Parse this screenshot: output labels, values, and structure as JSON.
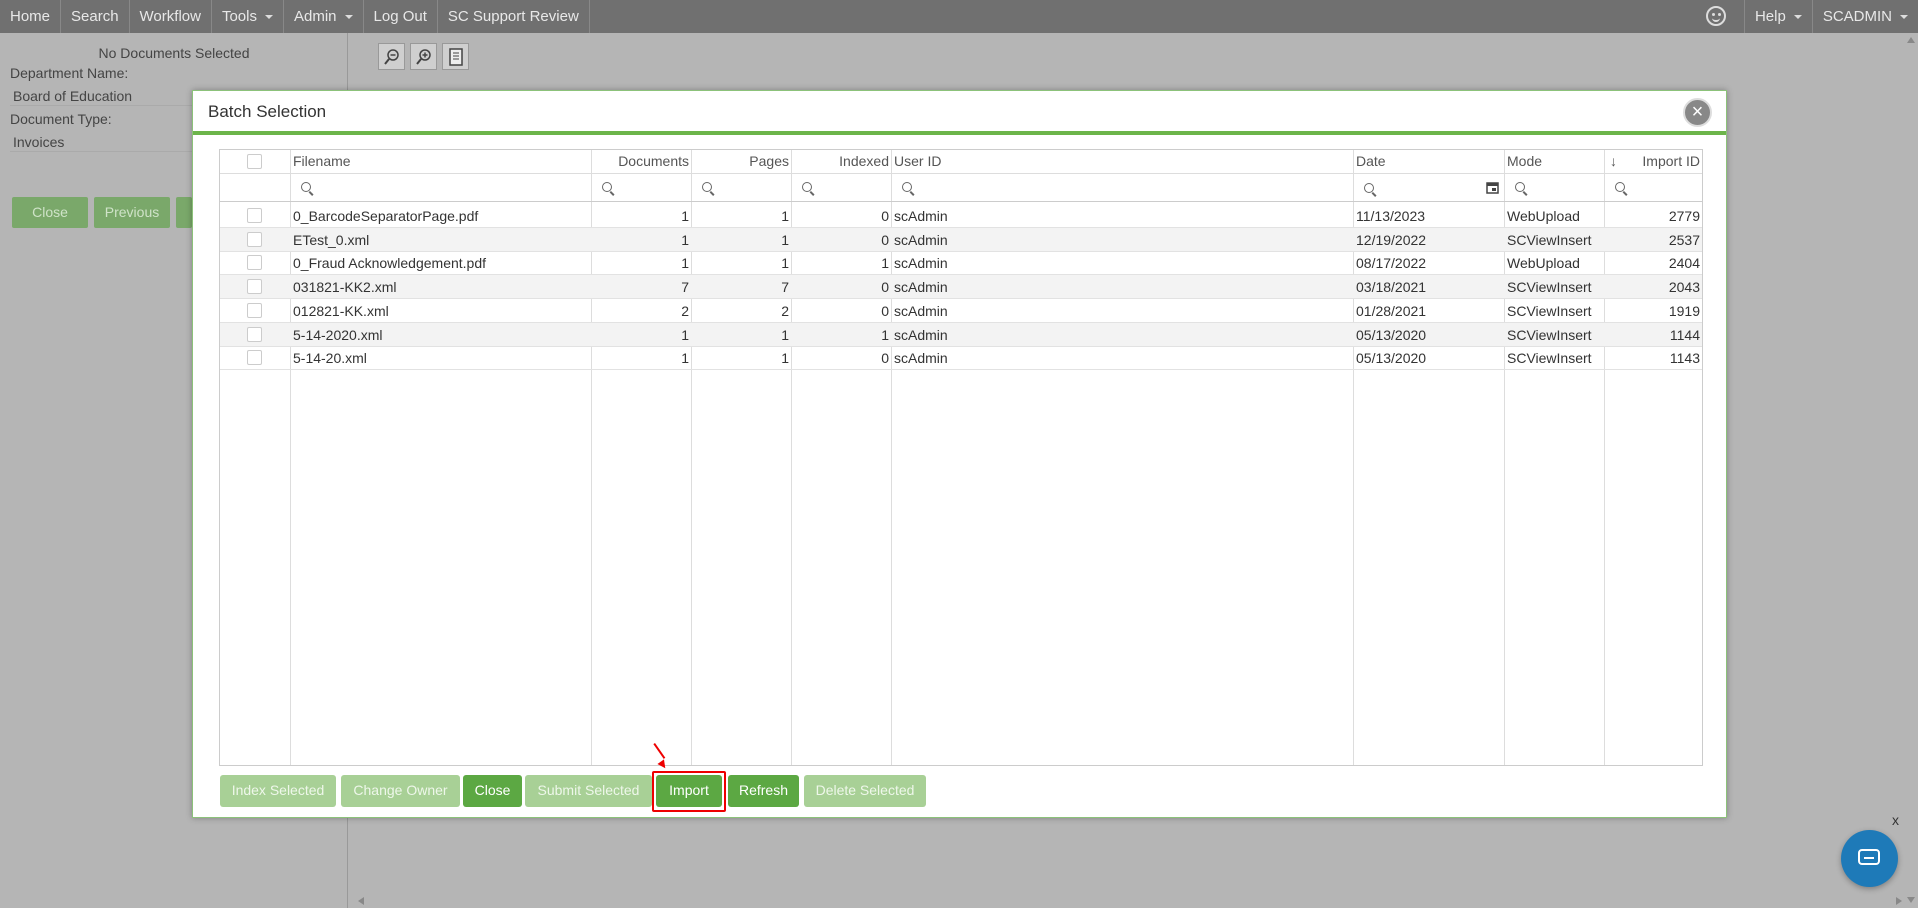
{
  "nav": {
    "items": [
      {
        "label": "Home",
        "dropdown": false
      },
      {
        "label": "Search",
        "dropdown": false
      },
      {
        "label": "Workflow",
        "dropdown": false
      },
      {
        "label": "Tools",
        "dropdown": true
      },
      {
        "label": "Admin",
        "dropdown": true
      },
      {
        "label": "Log Out",
        "dropdown": false
      },
      {
        "label": "SC Support Review",
        "dropdown": false
      }
    ],
    "help": "Help",
    "user": "SCADMIN"
  },
  "left": {
    "no_docs": "No Documents Selected",
    "dept_label": "Department Name:",
    "dept_value": "Board of Education",
    "doctype_label": "Document Type:",
    "doctype_value": "Invoices",
    "close_btn": "Close",
    "previous_btn": "Previous"
  },
  "modal": {
    "title": "Batch Selection",
    "close_icon": "×",
    "columns": {
      "filename": "Filename",
      "documents": "Documents",
      "pages": "Pages",
      "indexed": "Indexed",
      "user_id": "User ID",
      "date": "Date",
      "mode": "Mode",
      "import_id": "Import ID"
    },
    "sort_indicator": "↓",
    "rows": [
      {
        "filename": "0_BarcodeSeparatorPage.pdf",
        "documents": "1",
        "pages": "1",
        "indexed": "0",
        "user_id": "scAdmin",
        "date": "11/13/2023",
        "mode": "WebUpload",
        "import_id": "2779"
      },
      {
        "filename": "ETest_0.xml",
        "documents": "1",
        "pages": "1",
        "indexed": "0",
        "user_id": "scAdmin",
        "date": "12/19/2022",
        "mode": "SCViewInsert",
        "import_id": "2537"
      },
      {
        "filename": "0_Fraud Acknowledgement.pdf",
        "documents": "1",
        "pages": "1",
        "indexed": "1",
        "user_id": "scAdmin",
        "date": "08/17/2022",
        "mode": "WebUpload",
        "import_id": "2404"
      },
      {
        "filename": "031821-KK2.xml",
        "documents": "7",
        "pages": "7",
        "indexed": "0",
        "user_id": "scAdmin",
        "date": "03/18/2021",
        "mode": "SCViewInsert",
        "import_id": "2043"
      },
      {
        "filename": "012821-KK.xml",
        "documents": "2",
        "pages": "2",
        "indexed": "0",
        "user_id": "scAdmin",
        "date": "01/28/2021",
        "mode": "SCViewInsert",
        "import_id": "1919"
      },
      {
        "filename": "5-14-2020.xml",
        "documents": "1",
        "pages": "1",
        "indexed": "1",
        "user_id": "scAdmin",
        "date": "05/13/2020",
        "mode": "SCViewInsert",
        "import_id": "1144"
      },
      {
        "filename": "5-14-20.xml",
        "documents": "1",
        "pages": "1",
        "indexed": "0",
        "user_id": "scAdmin",
        "date": "05/13/2020",
        "mode": "SCViewInsert",
        "import_id": "1143"
      }
    ],
    "buttons": {
      "index_selected": "Index Selected",
      "change_owner": "Change Owner",
      "close": "Close",
      "submit_selected": "Submit Selected",
      "import": "Import",
      "refresh": "Refresh",
      "delete_selected": "Delete Selected"
    }
  },
  "misc": {
    "x_mark": "x"
  },
  "colors": {
    "accent": "#5ca843",
    "accent_disabled": "#a8d096",
    "highlight": "#e00000",
    "chat": "#1e7ab8"
  }
}
